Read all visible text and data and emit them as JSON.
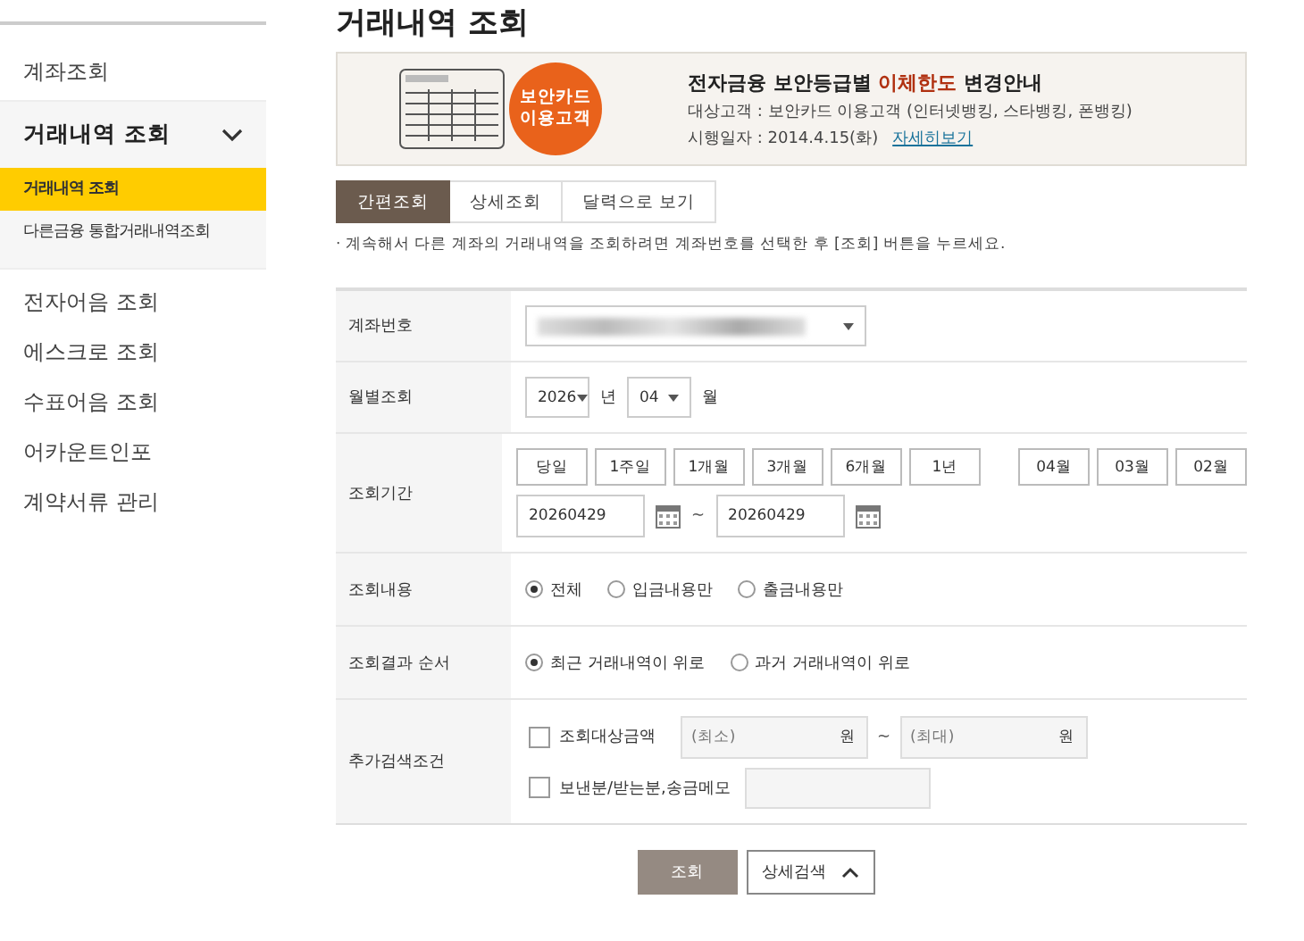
{
  "sidebar": {
    "items": [
      {
        "label": "계좌조회",
        "expanded": false
      },
      {
        "label": "거래내역 조회",
        "expanded": true,
        "children": [
          {
            "label": "거래내역 조회",
            "selected": true
          },
          {
            "label": "다른금융 통합거래내역조회",
            "selected": false
          }
        ]
      },
      {
        "label": "전자어음 조회",
        "expanded": false
      },
      {
        "label": "에스크로 조회",
        "expanded": false
      },
      {
        "label": "수표어음 조회",
        "expanded": false
      },
      {
        "label": "어카운트인포",
        "expanded": false
      },
      {
        "label": "계약서류 관리",
        "expanded": false
      }
    ]
  },
  "page_title": "거래내역 조회",
  "banner": {
    "badge": [
      "보안카드",
      "이용고객"
    ],
    "title": "전자금융 보안등급별 **이체한도** 변경안내",
    "lines": [
      "대상고객 : 보안카드 이용고객 (인터넷뱅킹, 스타뱅킹, 폰뱅킹)",
      "시행일자 : 2014.4.15(화)"
    ],
    "link": "자세히보기"
  },
  "tabs": [
    {
      "label": "간편조회",
      "selected": true
    },
    {
      "label": "상세조회",
      "selected": false
    },
    {
      "label": "달력으로 보기",
      "selected": false
    }
  ],
  "note": "· 계속해서 다른 계좌의 거래내역을 조회하려면 계좌번호를 선택한 후 [조회] 버튼을 누르세요.",
  "form": {
    "account": {
      "label": "계좌번호"
    },
    "monthly": {
      "label": "월별조회",
      "year": "2026",
      "year_unit": "년",
      "month": "04",
      "month_unit": "월"
    },
    "period": {
      "label": "조회기간",
      "ranges": [
        "당일",
        "1주일",
        "1개월",
        "3개월",
        "6개월",
        "1년"
      ],
      "months": [
        "04월",
        "03월",
        "02월"
      ],
      "from": "20260429",
      "separator": "~",
      "to": "20260429"
    },
    "content": {
      "label": "조회내용",
      "options": [
        {
          "label": "전체",
          "selected": true
        },
        {
          "label": "입금내용만",
          "selected": false
        },
        {
          "label": "출금내용만",
          "selected": false
        }
      ]
    },
    "order": {
      "label": "조회결과 순서",
      "options": [
        {
          "label": "최근 거래내역이 위로",
          "selected": true
        },
        {
          "label": "과거 거래내역이 위로",
          "selected": false
        }
      ]
    },
    "extra": {
      "label": "추가검색조건",
      "amount": {
        "label": "조회대상금액",
        "checked": false,
        "min_placeholder": "(최소)",
        "min_unit": "원",
        "separator": "~",
        "max_placeholder": "(최대)",
        "max_unit": "원"
      },
      "memo": {
        "label": "보낸분/받는분,송금메모",
        "checked": false
      }
    }
  },
  "buttons": {
    "search": "조회",
    "detail": "상세검색"
  }
}
